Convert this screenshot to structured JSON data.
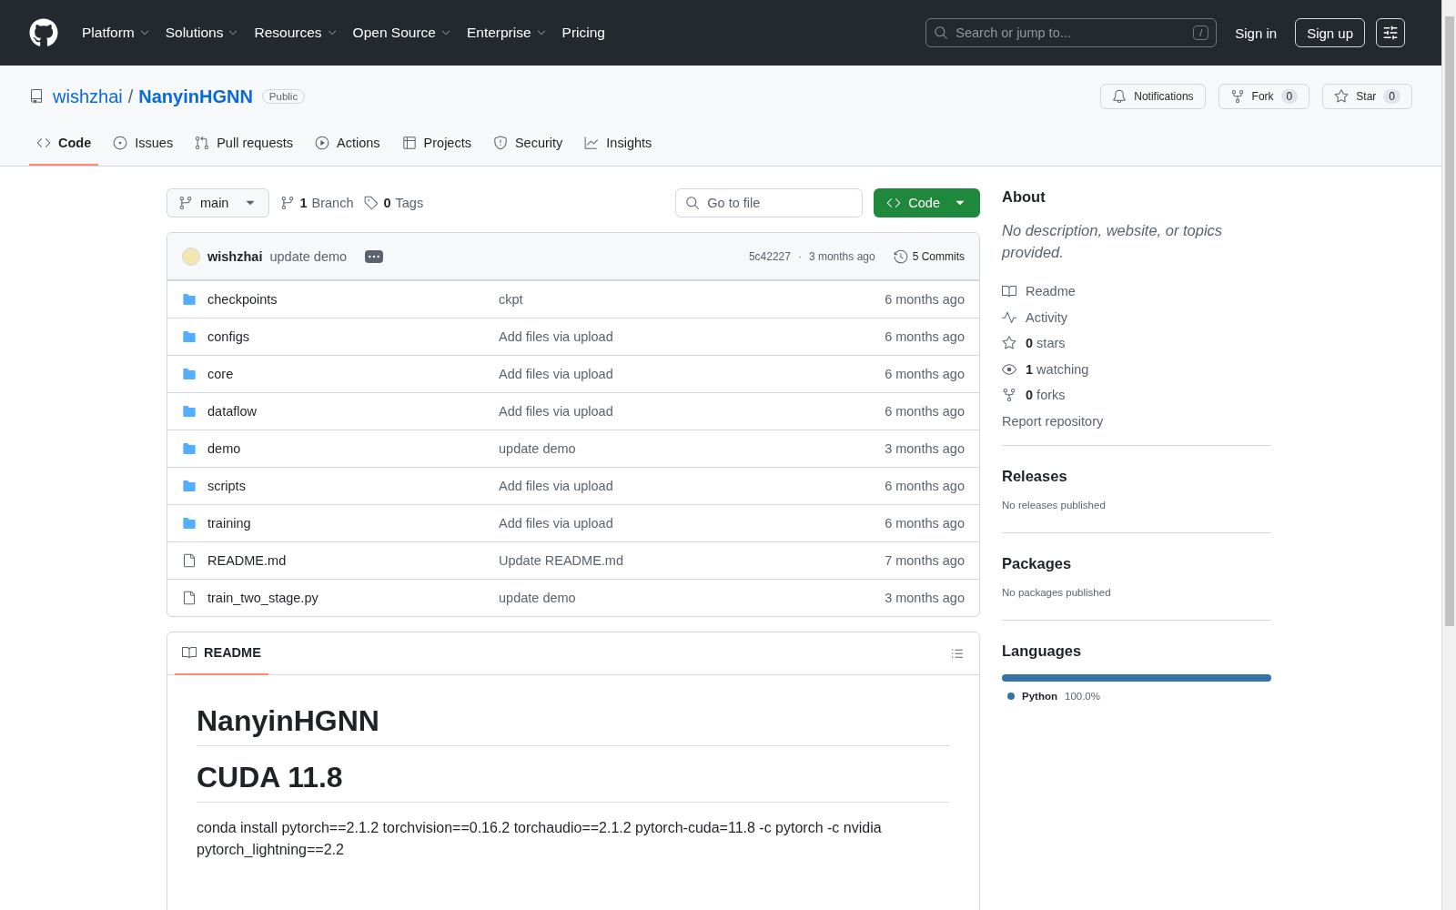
{
  "header": {
    "nav": [
      {
        "label": "Platform",
        "dropdown": true
      },
      {
        "label": "Solutions",
        "dropdown": true
      },
      {
        "label": "Resources",
        "dropdown": true
      },
      {
        "label": "Open Source",
        "dropdown": true
      },
      {
        "label": "Enterprise",
        "dropdown": true
      },
      {
        "label": "Pricing",
        "dropdown": false
      }
    ],
    "search": {
      "placeholder": "Search or jump to...",
      "shortcut": "/"
    },
    "sign_in": "Sign in",
    "sign_up": "Sign up"
  },
  "repo": {
    "owner": "wishzhai",
    "separator": "/",
    "name": "NanyinHGNN",
    "visibility": "Public",
    "actions": [
      {
        "label": "Notifications",
        "kind": "bell"
      },
      {
        "label": "Fork",
        "count": "0",
        "kind": "fork"
      },
      {
        "label": "Star",
        "count": "0",
        "kind": "star"
      }
    ]
  },
  "tabs": [
    {
      "label": "Code",
      "kind": "code",
      "selected": true
    },
    {
      "label": "Issues",
      "kind": "issues",
      "selected": false
    },
    {
      "label": "Pull requests",
      "kind": "pr",
      "selected": false
    },
    {
      "label": "Actions",
      "kind": "actions",
      "selected": false
    },
    {
      "label": "Projects",
      "kind": "projects",
      "selected": false
    },
    {
      "label": "Security",
      "kind": "security",
      "selected": false
    },
    {
      "label": "Insights",
      "kind": "insights",
      "selected": false
    }
  ],
  "toolbar": {
    "branch": "main",
    "branches_count": "1",
    "branches_label": "Branch",
    "tags_count": "0",
    "tags_label": "Tags",
    "go_to_file": "Go to file",
    "code_button": "Code"
  },
  "latest_commit": {
    "author": "wishzhai",
    "message": "update demo",
    "hash": "5c42227",
    "separator": "·",
    "time": "3 months ago",
    "commits": "5 Commits"
  },
  "files": [
    {
      "name": "checkpoints",
      "kind": "folder",
      "message": "ckpt",
      "time": "6 months ago"
    },
    {
      "name": "configs",
      "kind": "folder",
      "message": "Add files via upload",
      "time": "6 months ago"
    },
    {
      "name": "core",
      "kind": "folder",
      "message": "Add files via upload",
      "time": "6 months ago"
    },
    {
      "name": "dataflow",
      "kind": "folder",
      "message": "Add files via upload",
      "time": "6 months ago"
    },
    {
      "name": "demo",
      "kind": "folder",
      "message": "update demo",
      "time": "3 months ago"
    },
    {
      "name": "scripts",
      "kind": "folder",
      "message": "Add files via upload",
      "time": "6 months ago"
    },
    {
      "name": "training",
      "kind": "folder",
      "message": "Add files via upload",
      "time": "6 months ago"
    },
    {
      "name": "README.md",
      "kind": "file",
      "message": "Update README.md",
      "time": "7 months ago"
    },
    {
      "name": "train_two_stage.py",
      "kind": "file",
      "message": "update demo",
      "time": "3 months ago"
    }
  ],
  "readme": {
    "tab": "README",
    "blocks": [
      {
        "kind": "h1",
        "text": "NanyinHGNN"
      },
      {
        "kind": "h1",
        "text": "CUDA 11.8"
      },
      {
        "kind": "p",
        "text": "conda install pytorch==2.1.2 torchvision==0.16.2 torchaudio==2.1.2 pytorch-cuda=11.8 -c pytorch -c nvidia pytorch_lightning==2.2"
      }
    ]
  },
  "about": {
    "title": "About",
    "description": "No description, website, or topics provided.",
    "links": [
      {
        "kind": "readme",
        "label": "Readme"
      },
      {
        "kind": "activity",
        "label": "Activity"
      },
      {
        "kind": "stars",
        "count": "0",
        "label": "stars"
      },
      {
        "kind": "watching",
        "count": "1",
        "label": "watching"
      },
      {
        "kind": "forks",
        "count": "0",
        "label": "forks"
      }
    ],
    "report": "Report repository"
  },
  "releases": {
    "title": "Releases",
    "note": "No releases published"
  },
  "packages": {
    "title": "Packages",
    "note": "No packages published"
  },
  "languages": {
    "title": "Languages",
    "items": [
      {
        "name": "Python",
        "percent": "100.0%",
        "level": 1.0,
        "color": "#3572a5"
      }
    ]
  }
}
